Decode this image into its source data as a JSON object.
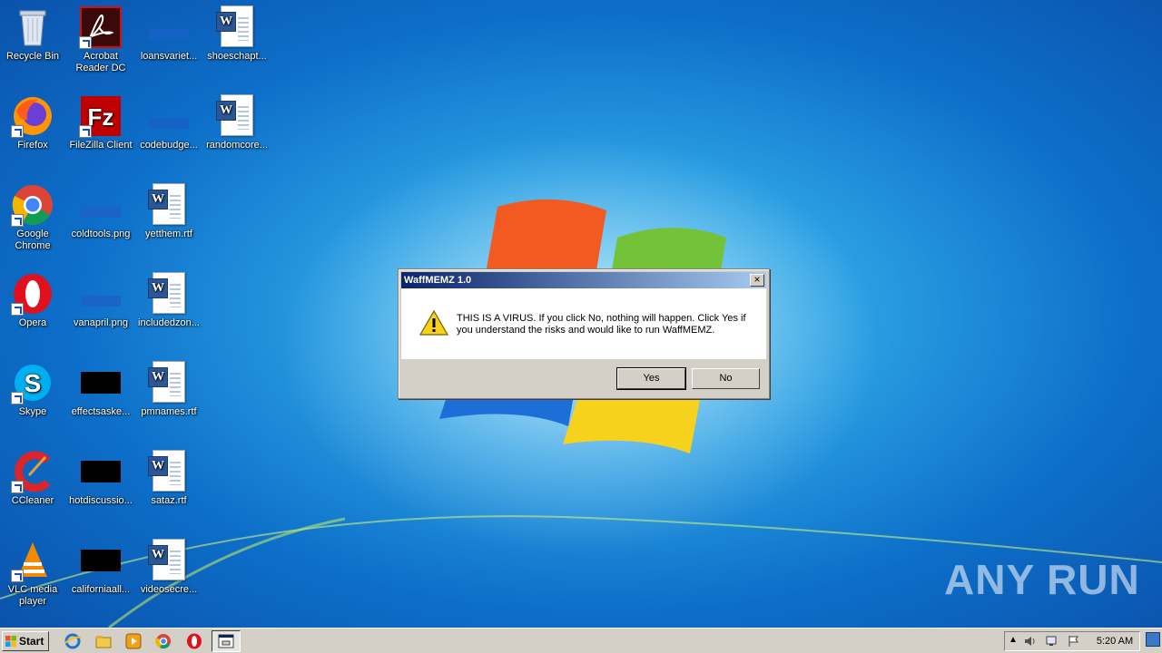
{
  "desktop": {
    "icons": [
      {
        "label": "Recycle Bin"
      },
      {
        "label": "Acrobat Reader DC"
      },
      {
        "label": "loansvariet..."
      },
      {
        "label": "shoeschapt..."
      },
      {
        "label": "Firefox"
      },
      {
        "label": "FileZilla Client"
      },
      {
        "label": "codebudge..."
      },
      {
        "label": "randomcore..."
      },
      {
        "label": "Google Chrome"
      },
      {
        "label": "coldtools.png"
      },
      {
        "label": "yetthem.rtf"
      },
      {
        "label": "Opera"
      },
      {
        "label": "vanapril.png"
      },
      {
        "label": "includedzon..."
      },
      {
        "label": "Skype"
      },
      {
        "label": "effectsaske..."
      },
      {
        "label": "pmnames.rtf"
      },
      {
        "label": "CCleaner"
      },
      {
        "label": "hotdiscussio..."
      },
      {
        "label": "sataz.rtf"
      },
      {
        "label": "VLC media player"
      },
      {
        "label": "californiaall..."
      },
      {
        "label": "videosecre..."
      }
    ]
  },
  "dialog": {
    "title": "WaffMEMZ 1.0",
    "close_glyph": "×",
    "message": "THIS IS A VIRUS. If you click No, nothing will happen. Click Yes if you understand the risks and would like to run WaffMEMZ.",
    "yes_label": "Yes",
    "no_label": "No"
  },
  "taskbar": {
    "start_label": "Start",
    "clock": "5:20 AM",
    "pinned": [
      "internet-explorer-icon",
      "explorer-icon",
      "media-player-icon",
      "chrome-icon",
      "opera-icon",
      "dialog-app-icon"
    ]
  },
  "watermark": "ANY RUN",
  "colors": {
    "titlebar_start": "#0a246a",
    "titlebar_end": "#a6caf0",
    "dialog_face": "#d4d0c8",
    "desktop_blue": "#0d6fc9"
  }
}
